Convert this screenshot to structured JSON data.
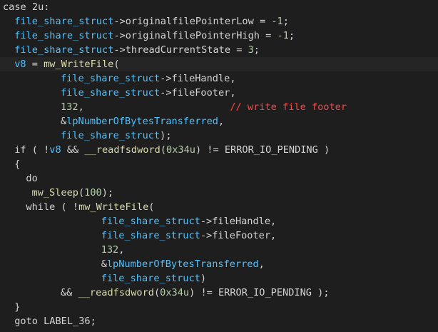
{
  "colors": {
    "background": "#1e1e1e",
    "current_line": "#252526",
    "plain": "#d4d4d4",
    "variable": "#4fc1ff",
    "field": "#d4d4d4",
    "function": "#dcdcaa",
    "number": "#b5cea8",
    "comment": "#f44747",
    "constant": "#d4d4d4",
    "keyword": "#d4d4d4",
    "macro": "#dcdcaa"
  },
  "lines": [
    {
      "indent": 0,
      "highlight": false,
      "tokens": [
        {
          "t": "case 2u:",
          "c": "keyword"
        }
      ]
    },
    {
      "indent": 2,
      "highlight": false,
      "tokens": [
        {
          "t": "file_share_struct",
          "c": "variable"
        },
        {
          "t": "->",
          "c": "plain"
        },
        {
          "t": "originalfilePointerLow",
          "c": "field"
        },
        {
          "t": " = ",
          "c": "plain"
        },
        {
          "t": "-1",
          "c": "number"
        },
        {
          "t": ";",
          "c": "plain"
        }
      ]
    },
    {
      "indent": 2,
      "highlight": false,
      "tokens": [
        {
          "t": "file_share_struct",
          "c": "variable"
        },
        {
          "t": "->",
          "c": "plain"
        },
        {
          "t": "originalfilePointerHigh",
          "c": "field"
        },
        {
          "t": " = ",
          "c": "plain"
        },
        {
          "t": "-1",
          "c": "number"
        },
        {
          "t": ";",
          "c": "plain"
        }
      ]
    },
    {
      "indent": 2,
      "highlight": false,
      "tokens": [
        {
          "t": "file_share_struct",
          "c": "variable"
        },
        {
          "t": "->",
          "c": "plain"
        },
        {
          "t": "threadCurrentState",
          "c": "field"
        },
        {
          "t": " = ",
          "c": "plain"
        },
        {
          "t": "3",
          "c": "number"
        },
        {
          "t": ";",
          "c": "plain"
        }
      ]
    },
    {
      "indent": 2,
      "highlight": true,
      "tokens": [
        {
          "t": "v8",
          "c": "variable"
        },
        {
          "t": " = ",
          "c": "plain"
        },
        {
          "t": "mw_WriteFile",
          "c": "function"
        },
        {
          "t": "(",
          "c": "plain"
        }
      ]
    },
    {
      "indent": 10,
      "highlight": false,
      "tokens": [
        {
          "t": "file_share_struct",
          "c": "variable"
        },
        {
          "t": "->",
          "c": "plain"
        },
        {
          "t": "fileHandle",
          "c": "field"
        },
        {
          "t": ",",
          "c": "plain"
        }
      ]
    },
    {
      "indent": 10,
      "highlight": false,
      "tokens": [
        {
          "t": "file_share_struct",
          "c": "variable"
        },
        {
          "t": "->",
          "c": "plain"
        },
        {
          "t": "fileFooter",
          "c": "field"
        },
        {
          "t": ",",
          "c": "plain"
        }
      ]
    },
    {
      "indent": 10,
      "highlight": false,
      "tokens": [
        {
          "t": "132",
          "c": "number"
        },
        {
          "t": ",",
          "c": "plain"
        },
        {
          "t": "                         ",
          "c": "plain"
        },
        {
          "t": "// write file footer",
          "c": "comment"
        }
      ]
    },
    {
      "indent": 10,
      "highlight": false,
      "tokens": [
        {
          "t": "&",
          "c": "plain"
        },
        {
          "t": "lpNumberOfBytesTransferred",
          "c": "variable"
        },
        {
          "t": ",",
          "c": "plain"
        }
      ]
    },
    {
      "indent": 10,
      "highlight": false,
      "tokens": [
        {
          "t": "file_share_struct",
          "c": "variable"
        },
        {
          "t": ");",
          "c": "plain"
        }
      ]
    },
    {
      "indent": 2,
      "highlight": false,
      "tokens": [
        {
          "t": "if ( !",
          "c": "keyword"
        },
        {
          "t": "v8",
          "c": "variable"
        },
        {
          "t": " && ",
          "c": "plain"
        },
        {
          "t": "__readfsdword",
          "c": "macro"
        },
        {
          "t": "(",
          "c": "plain"
        },
        {
          "t": "0x34u",
          "c": "number"
        },
        {
          "t": ") != ",
          "c": "plain"
        },
        {
          "t": "ERROR_IO_PENDING",
          "c": "constant"
        },
        {
          "t": " )",
          "c": "plain"
        }
      ]
    },
    {
      "indent": 2,
      "highlight": false,
      "tokens": [
        {
          "t": "{",
          "c": "plain"
        }
      ]
    },
    {
      "indent": 4,
      "highlight": false,
      "tokens": [
        {
          "t": "do",
          "c": "keyword"
        }
      ]
    },
    {
      "indent": 5,
      "highlight": false,
      "tokens": [
        {
          "t": "mw_Sleep",
          "c": "function"
        },
        {
          "t": "(",
          "c": "plain"
        },
        {
          "t": "100",
          "c": "number"
        },
        {
          "t": ");",
          "c": "plain"
        }
      ]
    },
    {
      "indent": 4,
      "highlight": false,
      "tokens": [
        {
          "t": "while ( !",
          "c": "keyword"
        },
        {
          "t": "mw_WriteFile",
          "c": "function"
        },
        {
          "t": "(",
          "c": "plain"
        }
      ]
    },
    {
      "indent": 17,
      "highlight": false,
      "tokens": [
        {
          "t": "file_share_struct",
          "c": "variable"
        },
        {
          "t": "->",
          "c": "plain"
        },
        {
          "t": "fileHandle",
          "c": "field"
        },
        {
          "t": ",",
          "c": "plain"
        }
      ]
    },
    {
      "indent": 17,
      "highlight": false,
      "tokens": [
        {
          "t": "file_share_struct",
          "c": "variable"
        },
        {
          "t": "->",
          "c": "plain"
        },
        {
          "t": "fileFooter",
          "c": "field"
        },
        {
          "t": ",",
          "c": "plain"
        }
      ]
    },
    {
      "indent": 17,
      "highlight": false,
      "tokens": [
        {
          "t": "132",
          "c": "number"
        },
        {
          "t": ",",
          "c": "plain"
        }
      ]
    },
    {
      "indent": 17,
      "highlight": false,
      "tokens": [
        {
          "t": "&",
          "c": "plain"
        },
        {
          "t": "lpNumberOfBytesTransferred",
          "c": "variable"
        },
        {
          "t": ",",
          "c": "plain"
        }
      ]
    },
    {
      "indent": 17,
      "highlight": false,
      "tokens": [
        {
          "t": "file_share_struct",
          "c": "variable"
        },
        {
          "t": ")",
          "c": "plain"
        }
      ]
    },
    {
      "indent": 10,
      "highlight": false,
      "tokens": [
        {
          "t": "&& ",
          "c": "plain"
        },
        {
          "t": "__readfsdword",
          "c": "macro"
        },
        {
          "t": "(",
          "c": "plain"
        },
        {
          "t": "0x34u",
          "c": "number"
        },
        {
          "t": ") != ",
          "c": "plain"
        },
        {
          "t": "ERROR_IO_PENDING",
          "c": "constant"
        },
        {
          "t": " );",
          "c": "plain"
        }
      ]
    },
    {
      "indent": 2,
      "highlight": false,
      "tokens": [
        {
          "t": "}",
          "c": "plain"
        }
      ]
    },
    {
      "indent": 2,
      "highlight": false,
      "tokens": [
        {
          "t": "goto ",
          "c": "keyword"
        },
        {
          "t": "LABEL_36",
          "c": "plain"
        },
        {
          "t": ";",
          "c": "plain"
        }
      ]
    }
  ]
}
